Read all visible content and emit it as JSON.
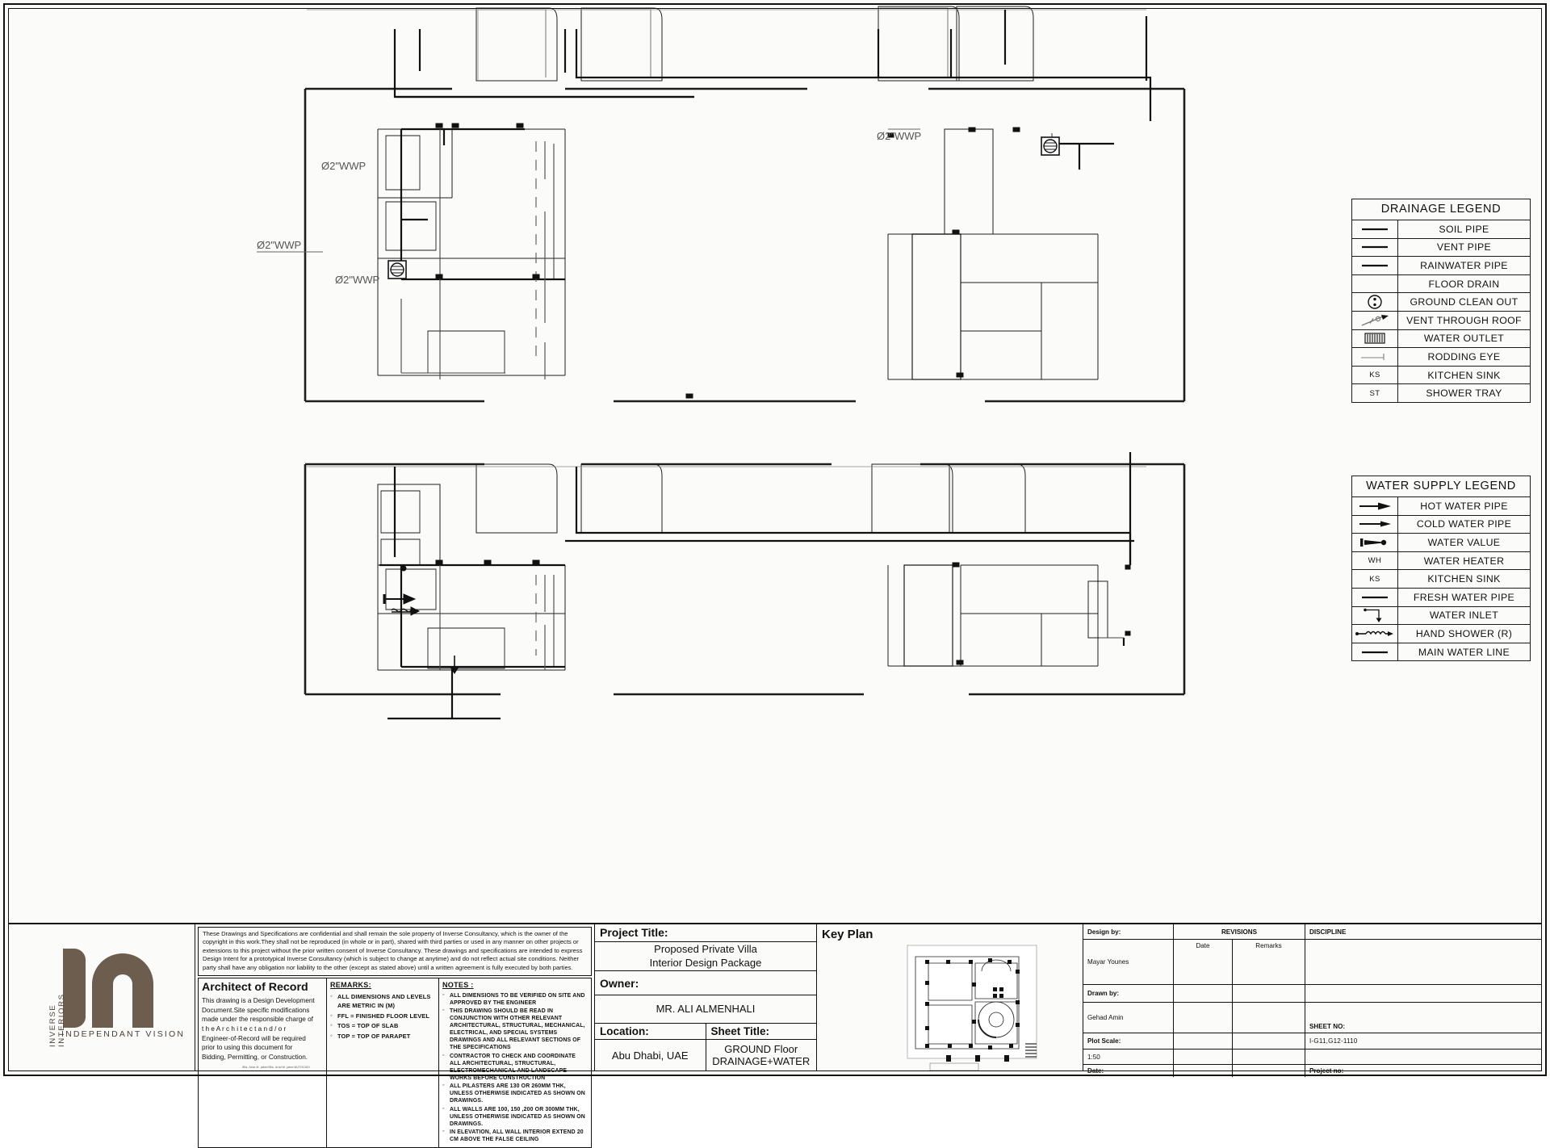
{
  "sheet": {
    "title": "GROUND Floor DRAINAGE+WATER",
    "drawing_labels": [
      {
        "text": "ø2\"WWP"
      },
      {
        "text": "ø2\"WWP"
      },
      {
        "text": "ø2\"WWP"
      },
      {
        "text": "ø2\"WWP"
      }
    ]
  },
  "legends": {
    "drainage": {
      "title": "DRAINAGE LEGEND",
      "rows": [
        {
          "symbol": "line-thick",
          "label": "SOIL PIPE"
        },
        {
          "symbol": "line-thick",
          "label": "VENT PIPE"
        },
        {
          "symbol": "line-thick",
          "label": "RAINWATER PIPE"
        },
        {
          "symbol": "blank",
          "label": "FLOOR DRAIN"
        },
        {
          "symbol": "clean-out-icon",
          "label": "GROUND CLEAN OUT"
        },
        {
          "symbol": "vent-roof-icon",
          "label": "VENT THROUGH ROOF"
        },
        {
          "symbol": "water-outlet-icon",
          "label": "WATER OUTLET"
        },
        {
          "symbol": "rodding-eye-icon",
          "label": "RODDING EYE"
        },
        {
          "symbol": "KS",
          "label": "KITCHEN SINK"
        },
        {
          "symbol": "ST",
          "label": "SHOWER TRAY"
        }
      ]
    },
    "water": {
      "title": "WATER SUPPLY LEGEND",
      "rows": [
        {
          "symbol": "arrow-long-icon",
          "label": "HOT WATER PIPE"
        },
        {
          "symbol": "arrow-short-icon",
          "label": "COLD WATER PIPE"
        },
        {
          "symbol": "valve-icon",
          "label": "WATER VALUE"
        },
        {
          "symbol": "WH",
          "label": "WATER HEATER"
        },
        {
          "symbol": "KS",
          "label": "KITCHEN SINK"
        },
        {
          "symbol": "line-thick",
          "label": "FRESH WATER PIPE"
        },
        {
          "symbol": "inlet-icon",
          "label": "WATER INLET"
        },
        {
          "symbol": "hand-shower-icon",
          "label": "HAND SHOWER (R)"
        },
        {
          "symbol": "line-thick",
          "label": "MAIN WATER LINE"
        }
      ]
    }
  },
  "logo": {
    "mark": "in",
    "vertical_text": "INVERSE INTERIORS",
    "tagline": "INDEPENDANT  VISION",
    "color": "#6d5d4e"
  },
  "copyright": "These Drawings and Specifications are confidential and shall remain the sole property of Inverse Consultancy, which is the owner of the copyright in this work.They shall not be reproduced (in whole or in part), shared with third parties or used in any manner on other projects or extensions to this project without the prior written consent of Inverse Consultancy. These drawings and specifications are intended to express Design Intent for a prototypical Inverse Consultancy (which is subject to change at anytime) and do not reflect actual site conditions.  Neither party shall have any obligation nor liability to the other (except as stated above) until a written agreement is fully executed by both parties.",
  "architect_of_record": {
    "heading": "Architect of Record",
    "body_line1": "This drawing is a Design Development",
    "body_line2": "Document.Site specific modifications",
    "body_line3": "made under the responsible charge of",
    "body_line4": "t h e   A r c h i t e c t   a n d / o r",
    "body_line5": "Engineer-of-Record will be required",
    "body_line6": "prior to using this document for",
    "body_line7": "Bidding, Permitting, or Construction.",
    "credit": "IBis, Arial M. jaber/IBis, Arial M. jaber/AUTOCAD/"
  },
  "remarks": {
    "heading": "REMARKS:",
    "items": [
      "ALL DIMENSIONS AND LEVELS ARE METRIC IN (M)",
      "FFL = FINISHED FLOOR LEVEL",
      "TOS = TOP OF SLAB",
      "TOP = TOP OF PARAPET"
    ]
  },
  "notes": {
    "heading": "NOTES  :",
    "items": [
      "ALL DIMENSIONS TO BE VERIFIED ON SITE AND APPROVED BY THE ENGINEER",
      "THIS DRAWING SHOULD BE READ IN CONJUNCTION WITH OTHER RELEVANT ARCHITECTURAL, STRUCTURAL, MECHANICAL, ELECTRICAL, AND SPECIAL SYSTEMS DRAWINGS AND ALL RELEVANT SECTIONS OF THE SPECIFICATIONS",
      "CONTRACTOR TO CHECK AND COORDINATE ALL ARCHITECTURAL, STRUCTURAL, ELECTROMECHANICAL AND LANDSCAPE WORKS BEFORE CONSTRUCTION",
      "ALL PILASTERS ARE 130 OR 260MM THK, UNLESS OTHERWISE INDICATED AS SHOWN ON DRAWINGS.",
      "ALL WALLS ARE 100, 150 ,200 OR 300MM THK, UNLESS OTHERWISE INDICATED AS SHOWN ON DRAWINGS.",
      "IN ELEVATION, ALL WALL INTERIOR EXTEND 20 CM ABOVE THE FALSE CEILING"
    ]
  },
  "project": {
    "title_label": "Project Title:",
    "title_line1": "Proposed Private Villa",
    "title_line2": "Interior Design Package",
    "owner_label": "Owner:",
    "owner_value": "MR. ALI ALMENHALI",
    "location_label": "Location:",
    "location_value": "Abu Dhabi, UAE",
    "sheet_title_label": "Sheet Title:",
    "sheet_title_line1": "GROUND Floor",
    "sheet_title_line2": "DRAINAGE+WATER"
  },
  "key_plan": {
    "label": "Key Plan"
  },
  "revisions": {
    "design_by_label": "Design by:",
    "design_by_value": "Mayar Younes",
    "drawn_by_label": "Drawn by:",
    "drawn_by_value": "Gehad Amin",
    "plot_scale_label": "Plot Scale:",
    "plot_scale_value": "1:50",
    "date_label": "Date:",
    "revisions_label": "REVISIONS",
    "col_date": "Date",
    "col_remarks": "Remarks",
    "discipline_label": "DISCIPLINE",
    "sheet_no_label": "SHEET NO:",
    "sheet_no_value": "I-G11,G12-1110",
    "project_no_label": "Project no:"
  }
}
